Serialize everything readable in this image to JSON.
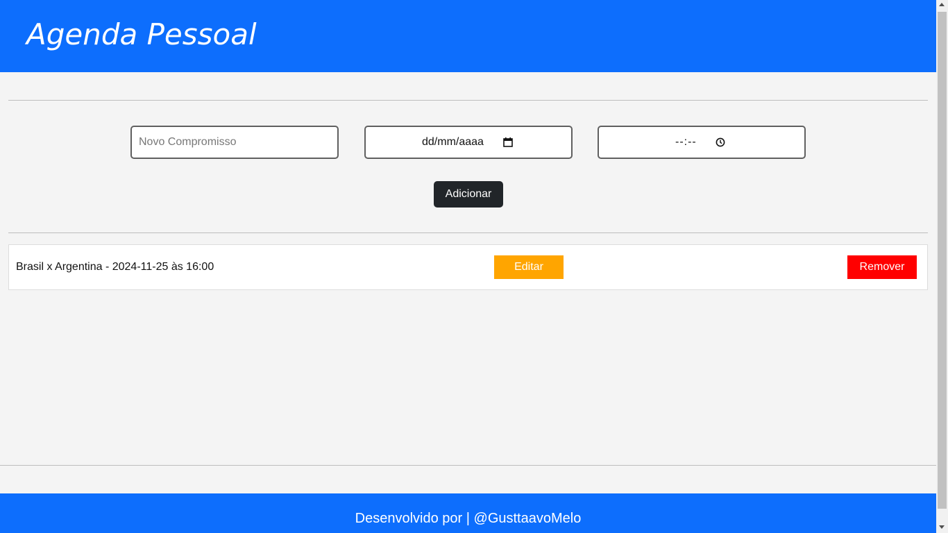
{
  "header": {
    "title": "Agenda Pessoal"
  },
  "form": {
    "task_placeholder": "Novo Compromisso",
    "date_placeholder": "dd/mm/aaaa",
    "time_placeholder": "--:--",
    "add_label": "Adicionar"
  },
  "appointments": [
    {
      "text": "Brasil x Argentina - 2024-11-25 às 16:00",
      "edit_label": "Editar",
      "remove_label": "Remover"
    }
  ],
  "footer": {
    "text": "Desenvolvido por | @GusttaavoMelo"
  },
  "colors": {
    "header_bg": "#0d6efd",
    "edit_button": "#ffa500",
    "remove_button": "#ff0000",
    "add_button": "#212529"
  },
  "icons": [
    "calendar-icon",
    "clock-icon"
  ]
}
